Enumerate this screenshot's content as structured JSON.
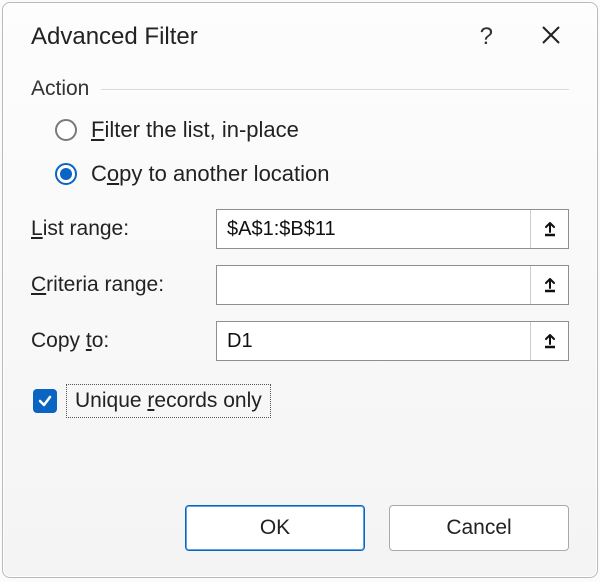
{
  "dialog": {
    "title": "Advanced Filter"
  },
  "group": {
    "action_label": "Action"
  },
  "radios": {
    "filter_in_place_pre": "F",
    "filter_in_place_post": "ilter the list, in-place",
    "copy_pre": "C",
    "copy_mid": "o",
    "copy_post": "py to another location"
  },
  "fields": {
    "list_range_accel": "L",
    "list_range_label_rest": "ist range:",
    "list_range_value": "$A$1:$B$11",
    "criteria_accel": "C",
    "criteria_label_rest": "riteria range:",
    "criteria_value": "",
    "copy_to_label_pre": "Copy ",
    "copy_to_accel": "t",
    "copy_to_label_post": "o:",
    "copy_to_value": "D1"
  },
  "checkbox": {
    "label_pre": "Unique ",
    "label_accel": "r",
    "label_post": "ecords only",
    "checked": true
  },
  "buttons": {
    "ok": "OK",
    "cancel": "Cancel"
  }
}
